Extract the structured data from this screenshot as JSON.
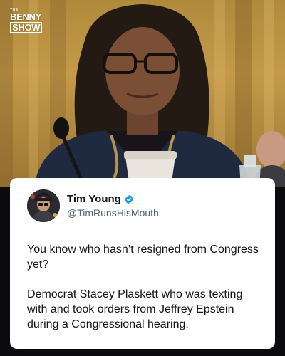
{
  "brand": {
    "the": "THE",
    "name": "BENNY",
    "show": "SHOW"
  },
  "tweet": {
    "display_name": "Tim Young",
    "handle": "@TimRunsHisMouth",
    "verified_icon": "verified-badge-icon",
    "verified_color": "#1d9bf0",
    "paragraphs": [
      "You know who hasn’t resigned from Congress yet?",
      "Democrat Stacey Plaskett who was texting with and took orders from Jeffrey Epstein during a Congressional hearing."
    ]
  }
}
